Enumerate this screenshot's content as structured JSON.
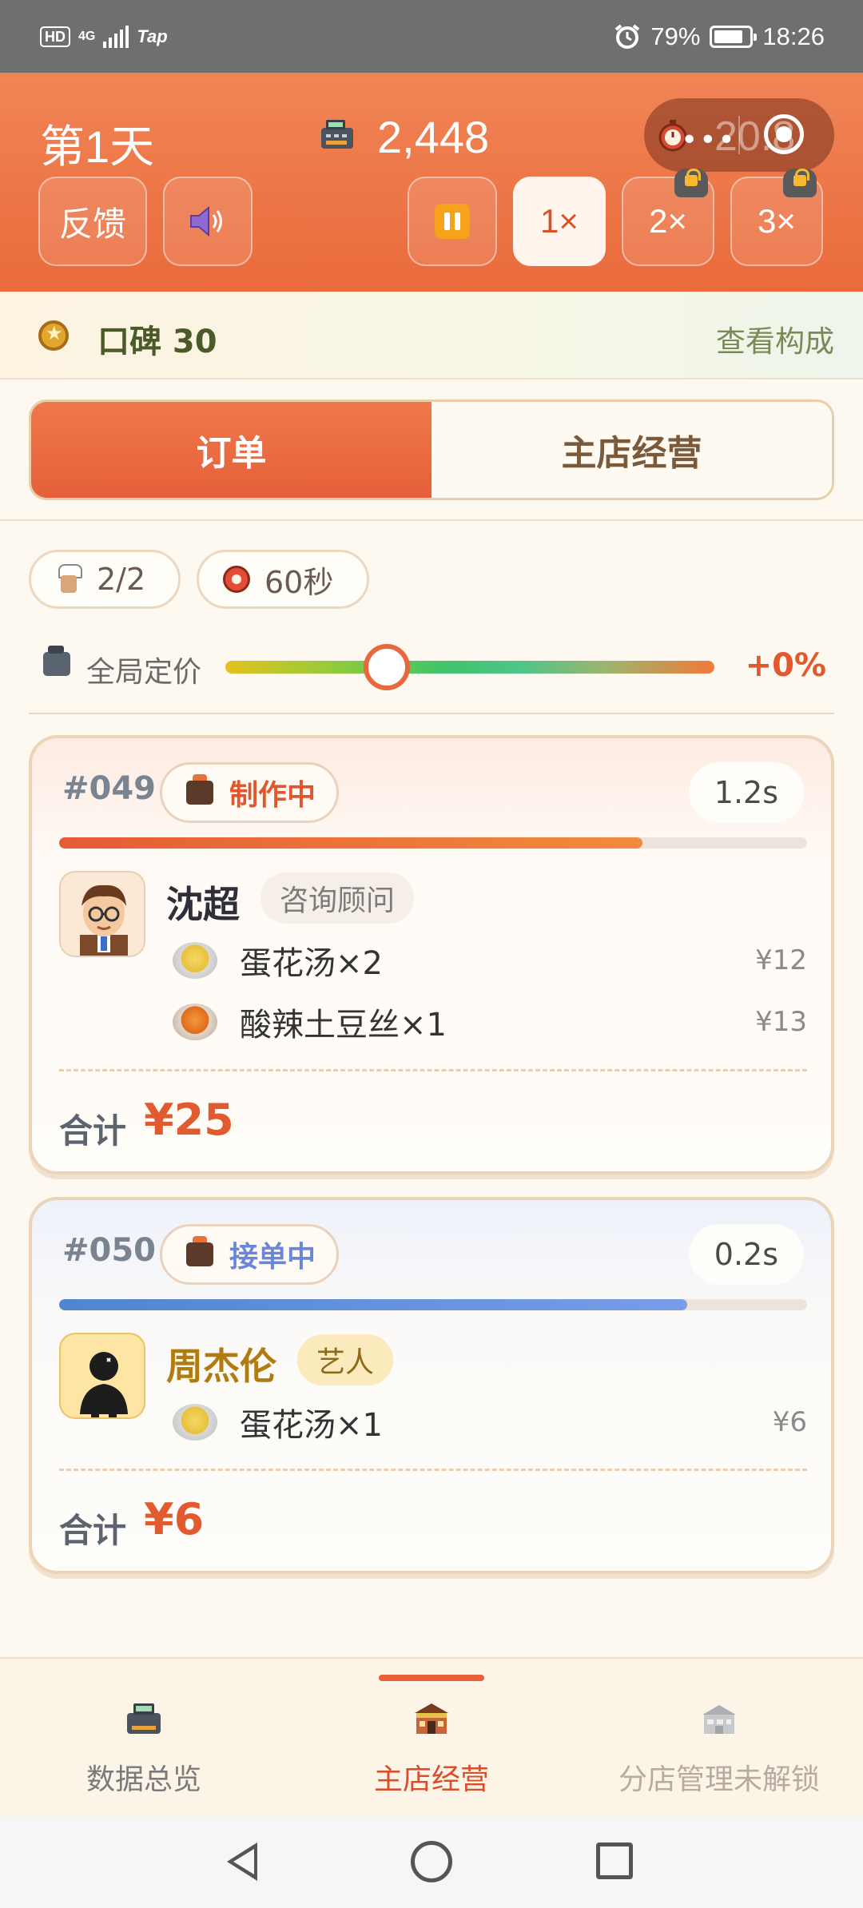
{
  "status_bar": {
    "hd": "HD",
    "network": "4G",
    "carrier": "Tap",
    "battery": "79%",
    "battery_level": 0.79,
    "time": "18:26"
  },
  "header": {
    "day": "第1天",
    "money": "2,448",
    "timer": "20.8",
    "feedback_label": "反馈",
    "speeds": [
      {
        "label": "1×",
        "active": true,
        "locked": false
      },
      {
        "label": "2×",
        "active": false,
        "locked": true
      },
      {
        "label": "3×",
        "active": false,
        "locked": true
      }
    ]
  },
  "reputation": {
    "label": "口碑 30",
    "link": "查看构成"
  },
  "tabs": [
    {
      "label": "订单",
      "active": true
    },
    {
      "label": "主店经营",
      "active": false
    }
  ],
  "chips": {
    "chefs": "2/2",
    "interval": "60秒"
  },
  "pricing": {
    "label": "全局定价",
    "value": "+0%",
    "slider_position": 0.33
  },
  "orders": [
    {
      "id": "#049",
      "status": "制作中",
      "elapsed": "1.2s",
      "progress": 0.78,
      "customer": "沈超",
      "role": "咨询顾问",
      "items": [
        {
          "name": "蛋花汤×2",
          "price": "¥12",
          "dish": "soup"
        },
        {
          "name": "酸辣土豆丝×1",
          "price": "¥13",
          "dish": "potato"
        }
      ],
      "total_label": "合计",
      "total": "¥25"
    },
    {
      "id": "#050",
      "status": "接单中",
      "elapsed": "0.2s",
      "progress": 0.84,
      "customer": "周杰伦",
      "role": "艺人",
      "items": [
        {
          "name": "蛋花汤×1",
          "price": "¥6",
          "dish": "soup"
        }
      ],
      "total_label": "合计",
      "total": "¥6"
    }
  ],
  "bottom_nav": [
    {
      "label": "数据总览",
      "icon": "cash-register-icon",
      "state": "normal"
    },
    {
      "label": "主店经营",
      "icon": "shop-icon",
      "state": "active"
    },
    {
      "label": "分店管理未解锁",
      "icon": "branch-building-icon",
      "state": "disabled"
    }
  ],
  "colors": {
    "accent": "#ea6a3c",
    "status_making": "#e0572d",
    "status_taking": "#6a86d8",
    "total": "#e15a30"
  }
}
